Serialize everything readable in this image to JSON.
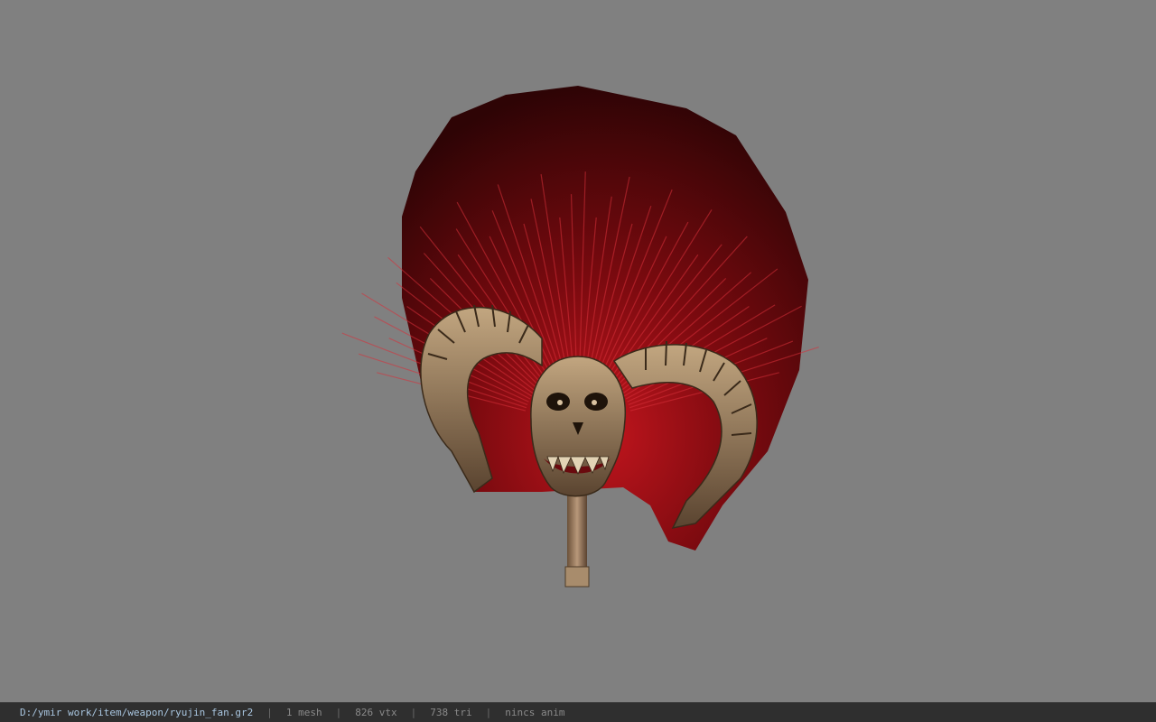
{
  "viewport": {
    "background_color": "#808080",
    "model_name": "ryujin_fan",
    "model_colors": {
      "plume_dark": "#3a0507",
      "plume_mid": "#7a0a0f",
      "plume_bright": "#c8202a",
      "bone": "#a08a6a",
      "bone_dark": "#4e3b28"
    }
  },
  "statusbar": {
    "file_path": "D:/ymir work/item/weapon/ryujin_fan.gr2",
    "mesh_count": "1 mesh",
    "vertex_count": "826 vtx",
    "triangle_count": "738 tri",
    "anim_status": "nincs anim",
    "separator": "|"
  }
}
